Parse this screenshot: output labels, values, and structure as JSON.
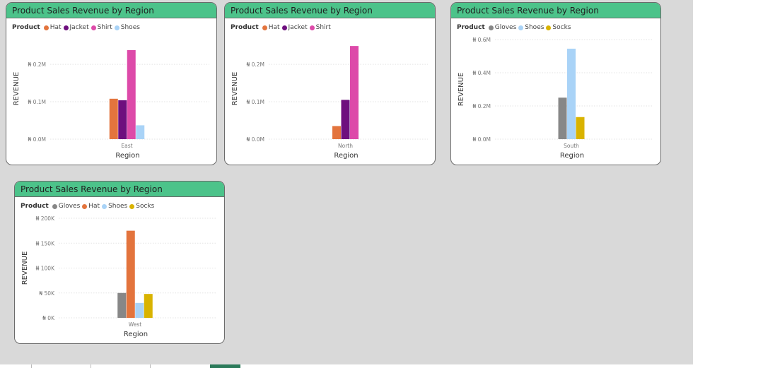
{
  "colors": {
    "Hat": "#e3743d",
    "Jacket": "#6e0f7e",
    "Shirt": "#dd4aa9",
    "Shoes": "#a9d3f7",
    "Gloves": "#878787",
    "Socks": "#d9b300",
    "header_bg": "#4cc38a",
    "canvas_bg": "#d9d9d9"
  },
  "legend_title": "Product",
  "chart_data": [
    {
      "type": "bar",
      "title": "Product Sales Revenue by Region",
      "xlabel": "Region",
      "ylabel": "REVENUE",
      "categories": [
        "East"
      ],
      "yticks": [
        "₦ 0.0M",
        "₦ 0.1M",
        "₦ 0.2M"
      ],
      "ylim": [
        0,
        0.27
      ],
      "series": [
        {
          "name": "Hat",
          "values": [
            0.108
          ]
        },
        {
          "name": "Jacket",
          "values": [
            0.104
          ]
        },
        {
          "name": "Shirt",
          "values": [
            0.238
          ]
        },
        {
          "name": "Shoes",
          "values": [
            0.037
          ]
        }
      ]
    },
    {
      "type": "bar",
      "title": "Product Sales Revenue by Region",
      "xlabel": "Region",
      "ylabel": "REVENUE",
      "categories": [
        "North"
      ],
      "yticks": [
        "₦ 0.0M",
        "₦ 0.1M",
        "₦ 0.2M"
      ],
      "ylim": [
        0,
        0.27
      ],
      "series": [
        {
          "name": "Hat",
          "values": [
            0.035
          ]
        },
        {
          "name": "Jacket",
          "values": [
            0.105
          ]
        },
        {
          "name": "Shirt",
          "values": [
            0.249
          ]
        }
      ]
    },
    {
      "type": "bar",
      "title": "Product Sales Revenue by Region",
      "xlabel": "Region",
      "ylabel": "REVENUE",
      "categories": [
        "South"
      ],
      "yticks": [
        "₦ 0.0M",
        "₦ 0.2M",
        "₦ 0.4M",
        "₦ 0.6M"
      ],
      "ylim": [
        0,
        0.6
      ],
      "series": [
        {
          "name": "Gloves",
          "values": [
            0.25
          ]
        },
        {
          "name": "Shoes",
          "values": [
            0.545
          ]
        },
        {
          "name": "Socks",
          "values": [
            0.133
          ]
        }
      ]
    },
    {
      "type": "bar",
      "title": "Product Sales Revenue by Region",
      "xlabel": "Region",
      "ylabel": "REVENUE",
      "categories": [
        "West"
      ],
      "yticks": [
        "₦ 0K",
        "₦ 50K",
        "₦ 100K",
        "₦ 150K",
        "₦ 200K"
      ],
      "ylim": [
        0,
        200
      ],
      "series": [
        {
          "name": "Gloves",
          "values": [
            50
          ]
        },
        {
          "name": "Hat",
          "values": [
            175
          ]
        },
        {
          "name": "Shoes",
          "values": [
            30
          ]
        },
        {
          "name": "Socks",
          "values": [
            48
          ]
        }
      ]
    }
  ]
}
